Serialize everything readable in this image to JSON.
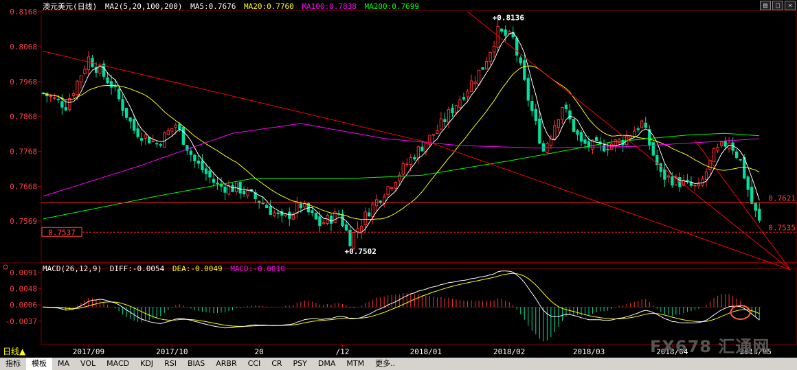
{
  "header": {
    "symbol": "澳元美元",
    "period": "(日线)",
    "ma_label": "MA2(5,20,100,200)",
    "ma5": "MA5:0.7676",
    "ma20": "MA20:0.7760",
    "ma100": "MA100:0.7838",
    "ma200": "MA200:0.7699"
  },
  "macd_header": {
    "label": "MACD(26,12,9)",
    "diff": "DIFF:-0.0054",
    "dea": "DEA:-0.0049",
    "macd": "MACD:-0.0010"
  },
  "window_buttons": [
    "▤",
    "□",
    "×"
  ],
  "colors": {
    "up": "#ff3232",
    "down": "#00e0a0",
    "ma5": "#ffffff",
    "ma20": "#ffff00",
    "ma100": "#ff00ff",
    "ma200": "#00ff00",
    "trend": "#ff0000",
    "dea": "#ffff00",
    "diff": "#ffffff"
  },
  "chart_data": {
    "type": "candlestick",
    "main_axis": {
      "ylim": [
        0.7455,
        0.8168
      ],
      "ticks": [
        "0.8168",
        "0.8068",
        "0.7968",
        "0.7868",
        "0.7768",
        "0.7668",
        "0.7569"
      ]
    },
    "macd_axis": {
      "ylim": [
        -0.0095,
        0.0098
      ],
      "ticks": [
        "0.0091",
        "0.0048",
        "0.0006",
        "-0.0037"
      ]
    },
    "x_labels": [
      "2017/09",
      "2017/10",
      "20",
      "/12",
      "2018/01",
      "2018/02",
      "2018/03",
      "2018/04",
      "2018/05"
    ],
    "x_label_index": [
      12,
      34,
      57,
      79,
      101,
      123,
      144,
      166,
      188
    ],
    "bars_total": 190,
    "anchors": [
      [
        0,
        0.7935
      ],
      [
        6,
        0.79
      ],
      [
        12,
        0.8035
      ],
      [
        18,
        0.796
      ],
      [
        24,
        0.783
      ],
      [
        30,
        0.779
      ],
      [
        35,
        0.7845
      ],
      [
        40,
        0.774
      ],
      [
        46,
        0.767
      ],
      [
        52,
        0.766
      ],
      [
        58,
        0.762
      ],
      [
        63,
        0.7572
      ],
      [
        68,
        0.7615
      ],
      [
        73,
        0.756
      ],
      [
        78,
        0.759
      ],
      [
        81,
        0.7515
      ],
      [
        86,
        0.76
      ],
      [
        92,
        0.768
      ],
      [
        98,
        0.776
      ],
      [
        104,
        0.783
      ],
      [
        110,
        0.792
      ],
      [
        116,
        0.801
      ],
      [
        120,
        0.811
      ],
      [
        124,
        0.809
      ],
      [
        128,
        0.792
      ],
      [
        132,
        0.777
      ],
      [
        137,
        0.79
      ],
      [
        142,
        0.779
      ],
      [
        147,
        0.778
      ],
      [
        153,
        0.78
      ],
      [
        158,
        0.785
      ],
      [
        163,
        0.77
      ],
      [
        168,
        0.768
      ],
      [
        173,
        0.766
      ],
      [
        177,
        0.776
      ],
      [
        181,
        0.78
      ],
      [
        184,
        0.774
      ],
      [
        187,
        0.762
      ],
      [
        190,
        0.7537
      ]
    ],
    "annotations": [
      {
        "text": "+0.8136",
        "index": 120,
        "value": 0.8136,
        "pos": "above"
      },
      {
        "text": "+0.7502",
        "index": 81,
        "value": 0.7502,
        "pos": "below"
      }
    ],
    "hlines": [
      {
        "value": 0.7621,
        "label": "0.7621",
        "style": "solid"
      },
      {
        "value": 0.7537,
        "label": "0.7535",
        "style": "dashed"
      }
    ],
    "current_price_label": "0.7537",
    "trendlines": [
      {
        "from": [
          0,
          0.8055
        ],
        "to": [
          103,
          0.779
        ]
      },
      {
        "from": [
          103,
          0.779
        ],
        "to": [
          226,
          0.743
        ]
      },
      {
        "from": [
          112,
          0.8168
        ],
        "to": [
          226,
          0.743
        ]
      },
      {
        "from": [
          172,
          0.78
        ],
        "to": [
          226,
          0.743
        ]
      }
    ],
    "ma100_anchors": [
      [
        0,
        0.764
      ],
      [
        25,
        0.7725
      ],
      [
        50,
        0.782
      ],
      [
        68,
        0.7848
      ],
      [
        90,
        0.7805
      ],
      [
        110,
        0.7785
      ],
      [
        130,
        0.7778
      ],
      [
        155,
        0.7782
      ],
      [
        175,
        0.7795
      ],
      [
        190,
        0.7805
      ]
    ],
    "ma200_anchors": [
      [
        0,
        0.7575
      ],
      [
        30,
        0.764
      ],
      [
        55,
        0.769
      ],
      [
        80,
        0.769
      ],
      [
        100,
        0.77
      ],
      [
        125,
        0.7745
      ],
      [
        150,
        0.7795
      ],
      [
        170,
        0.7815
      ],
      [
        180,
        0.782
      ],
      [
        190,
        0.7812
      ]
    ]
  },
  "bottom_bar": {
    "items": [
      "指标",
      "模板",
      "MA",
      "VOL",
      "MACD",
      "KDJ",
      "RSI",
      "BIAS",
      "ARBR",
      "CCI",
      "CR",
      "PSY",
      "DMA",
      "MTM",
      "更多.."
    ]
  },
  "day_line": "日线▲",
  "watermark": "FX678 汇通网"
}
